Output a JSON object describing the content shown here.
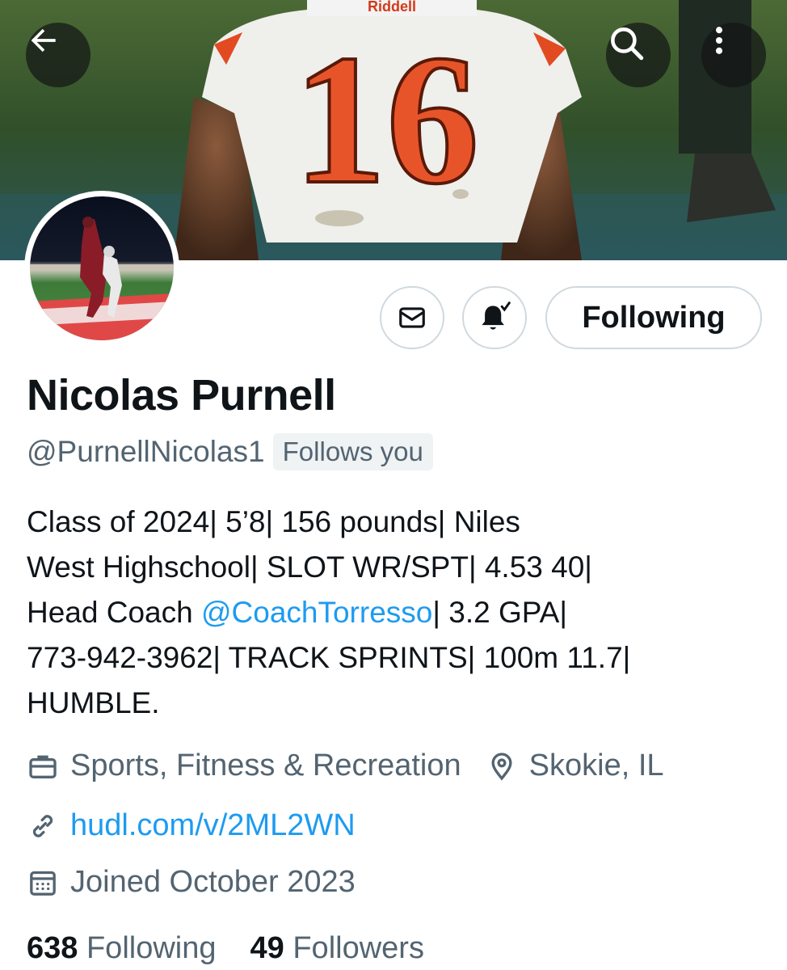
{
  "header": {
    "back_icon": "arrow-left-icon",
    "search_icon": "search-icon",
    "more_icon": "more-vertical-icon",
    "banner_jersey_number": "16",
    "banner_helmet_text": "Riddell"
  },
  "profile": {
    "name": "Nicolas Purnell",
    "handle": "@PurnellNicolas1",
    "follows_you": "Follows you",
    "bio": {
      "line1": "Class of 2024| 5’8| 156 pounds| Niles",
      "line2": "West Highschool| SLOT WR/SPT| 4.53 40|",
      "line3_prefix": "Head Coach ",
      "line3_mention": "@CoachTorresso",
      "line3_suffix": "| 3.2 GPA|",
      "line4": "773-942-3962| TRACK SPRINTS| 100m 11.7|",
      "line5": "HUMBLE."
    },
    "category": "Sports, Fitness & Recreation",
    "location": "Skokie, IL",
    "website": "hudl.com/v/2ML2WN",
    "joined": "Joined October 2023"
  },
  "actions": {
    "message_icon": "envelope-icon",
    "notify_icon": "bell-check-icon",
    "following_label": "Following"
  },
  "stats": {
    "following_count": "638",
    "following_label": "Following",
    "followers_count": "49",
    "followers_label": "Followers"
  },
  "colors": {
    "accent": "#1d9bf0",
    "secondary_text": "#536471",
    "primary_text": "#0f1419",
    "border": "#cfd9de",
    "jersey_number": "#e8542a"
  }
}
